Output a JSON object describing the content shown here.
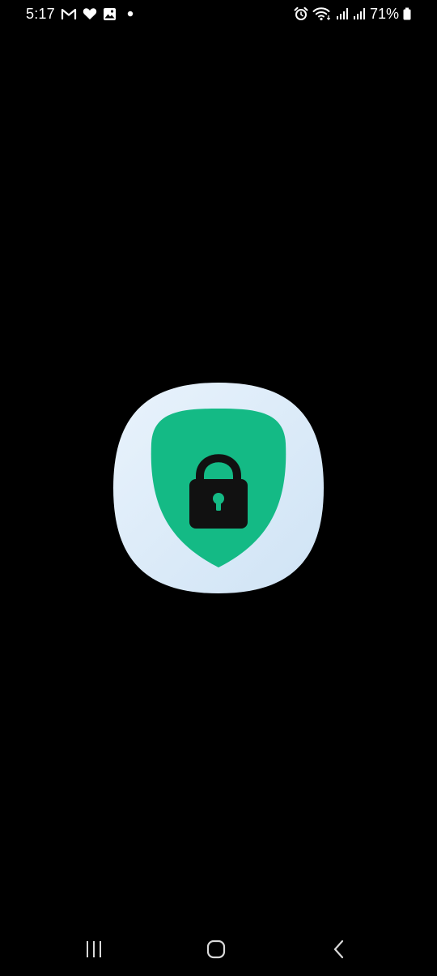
{
  "status_bar": {
    "time": "5:17",
    "left_icons": [
      "gmail-icon",
      "heart-icon",
      "gallery-icon",
      "notification-dot-icon"
    ],
    "right_icons": [
      "alarm-icon",
      "wifi-icon",
      "signal-icon",
      "signal-icon",
      "battery-icon"
    ],
    "battery_percent": "71%"
  },
  "app_icon": {
    "icon": "shield-lock-icon",
    "colors": {
      "squircle": "#dcebf9",
      "shield": "#14ba85",
      "lock": "#111111"
    }
  },
  "nav_bar": {
    "buttons": [
      "recents-icon",
      "home-icon",
      "back-icon"
    ]
  }
}
